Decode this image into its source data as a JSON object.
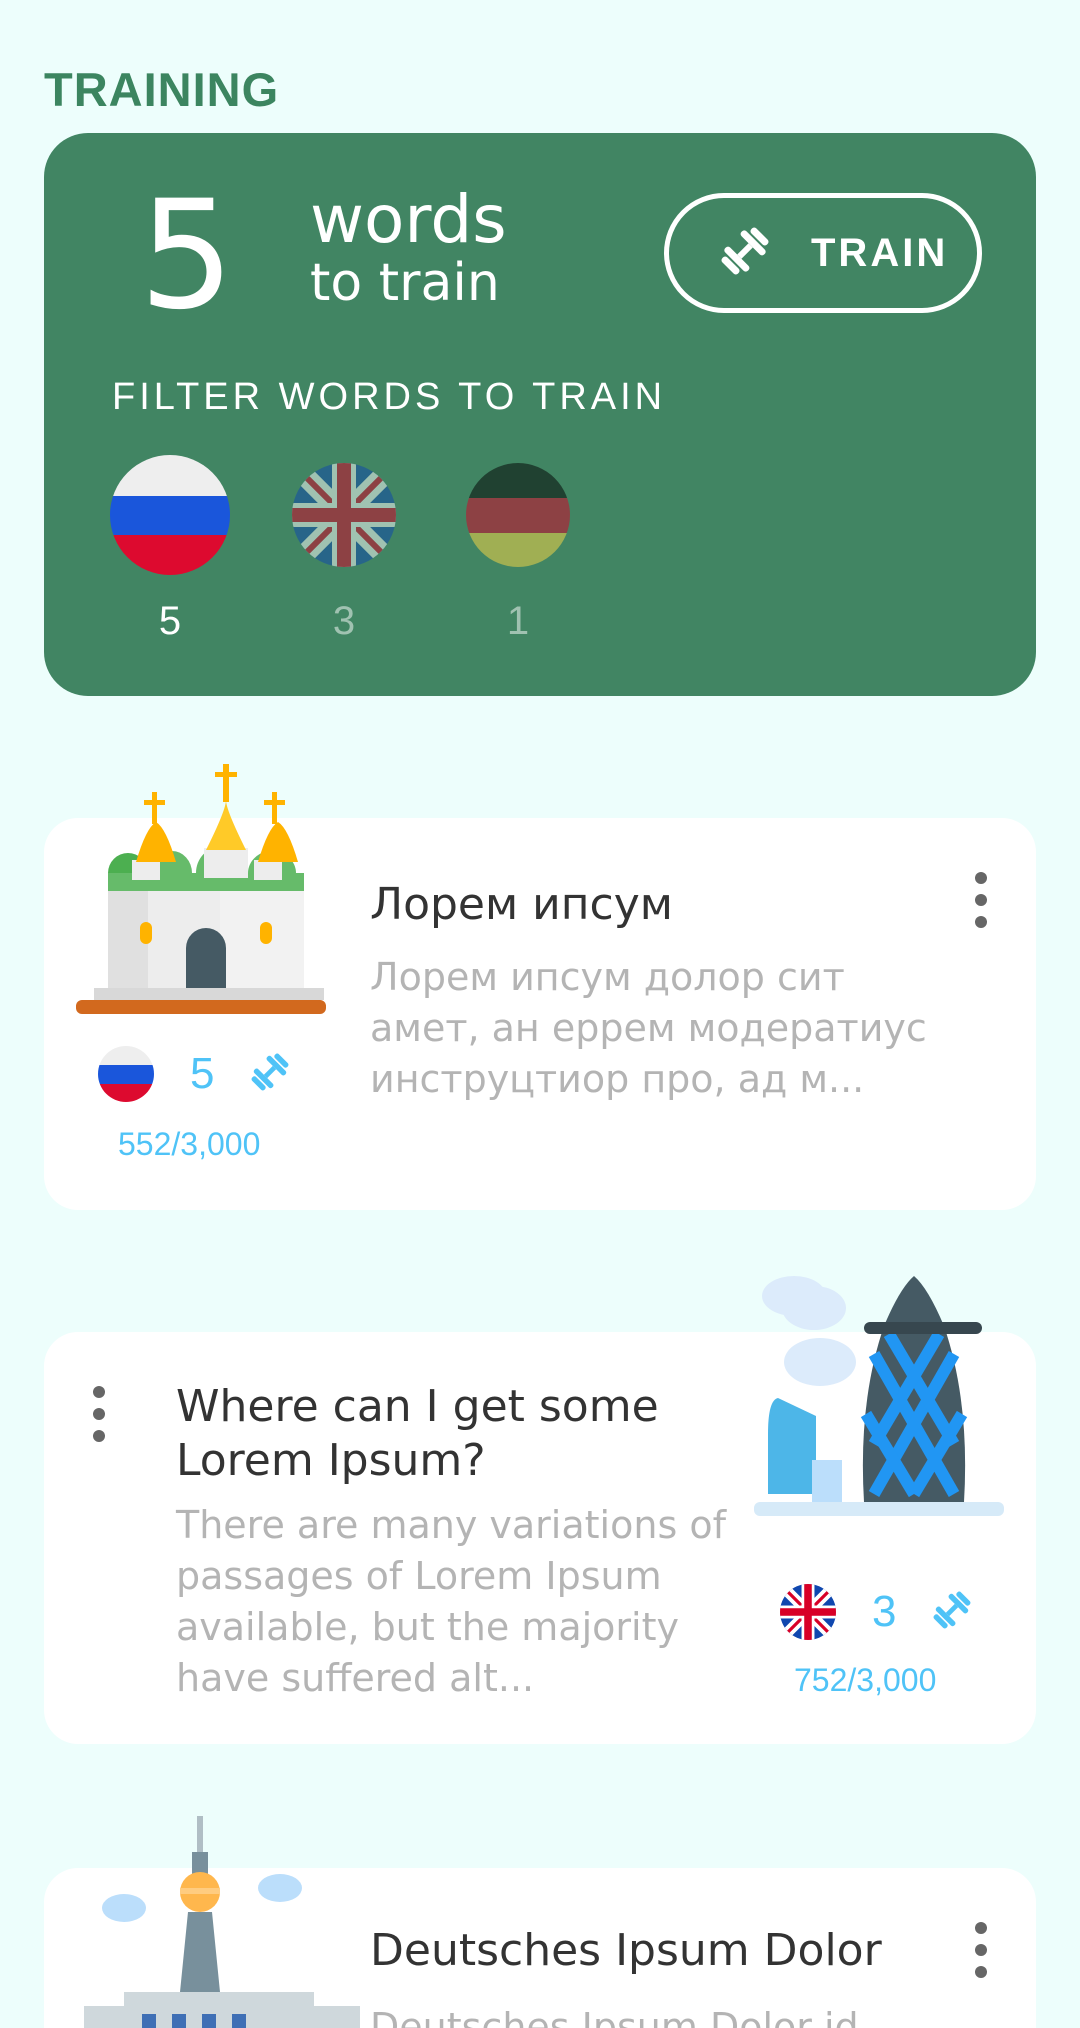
{
  "header": {
    "title": "TRAINING"
  },
  "training": {
    "count": "5",
    "words_label": "words",
    "to_train_label": "to train",
    "train_button": "TRAIN",
    "filter_title": "FILTER WORDS TO TRAIN",
    "filters": [
      {
        "language": "Russian",
        "icon": "russia-flag-icon",
        "count": "5",
        "selected": true
      },
      {
        "language": "English",
        "icon": "uk-flag-icon",
        "count": "3",
        "selected": false
      },
      {
        "language": "German",
        "icon": "germany-flag-icon",
        "count": "1",
        "selected": false
      }
    ]
  },
  "cards": [
    {
      "title": "Лорем ипсум",
      "description": "Лорем ипсум долор сит амет, ан еррем модератиус инструцтиор про, ад м...",
      "flag": "russia-flag-icon",
      "count": "5",
      "progress": "552/3,000",
      "illustration": "cathedral-illustration"
    },
    {
      "title": "Where can I get some Lorem Ipsum?",
      "description": "There are many variations of passages of Lorem Ipsum available, but the majority have suffered alt...",
      "flag": "uk-flag-icon",
      "count": "3",
      "progress": "752/3,000",
      "illustration": "gherkin-tower-illustration"
    },
    {
      "title": "Deutsches Ipsum Dolor",
      "description": "Deutsches Ipsum Dolor id",
      "flag": "germany-flag-icon",
      "illustration": "tv-tower-illustration"
    }
  ],
  "colors": {
    "background": "#EDFEFC",
    "card_green": "#418563",
    "accent_blue": "#4FC3F7",
    "title_green": "#3C8560"
  }
}
